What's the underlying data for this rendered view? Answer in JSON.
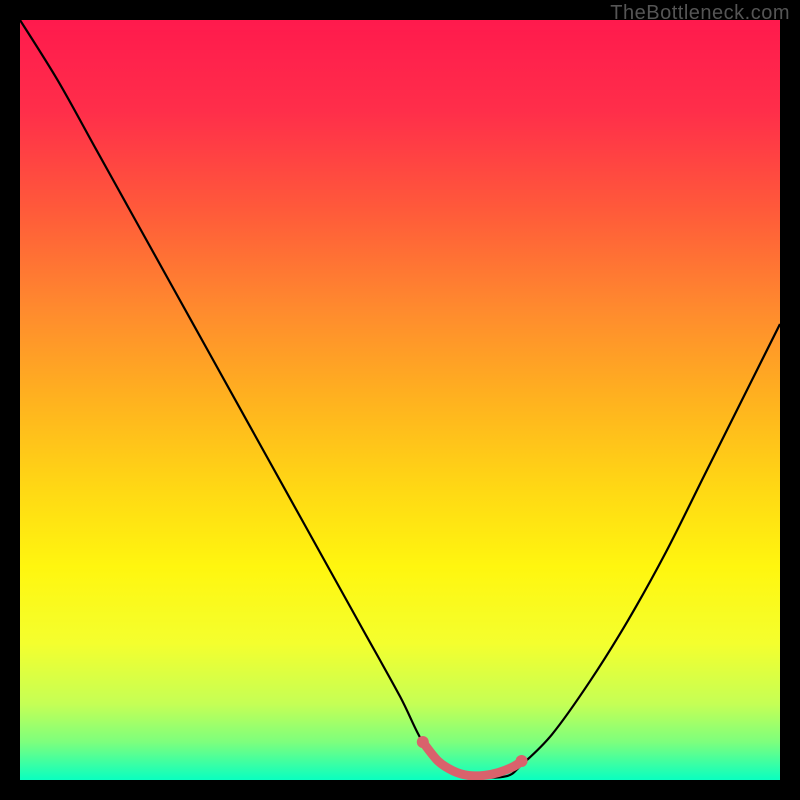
{
  "watermark": "TheBottleneck.com",
  "chart_data": {
    "type": "line",
    "title": "",
    "xlabel": "",
    "ylabel": "",
    "xlim": [
      0,
      100
    ],
    "ylim": [
      0,
      100
    ],
    "series": [
      {
        "name": "curve",
        "color": "#000000",
        "x": [
          0,
          5,
          10,
          15,
          20,
          25,
          30,
          35,
          40,
          45,
          50,
          53,
          56,
          60,
          64,
          66,
          70,
          75,
          80,
          85,
          90,
          95,
          100
        ],
        "y": [
          100,
          92,
          83,
          74,
          65,
          56,
          47,
          38,
          29,
          20,
          11,
          5,
          2,
          0.5,
          0.5,
          2,
          6,
          13,
          21,
          30,
          40,
          50,
          60
        ]
      },
      {
        "name": "highlight",
        "color": "#d9626c",
        "x": [
          53,
          55,
          57,
          59,
          61,
          63,
          65,
          66
        ],
        "y": [
          5,
          2.5,
          1.2,
          0.6,
          0.6,
          1.0,
          1.8,
          2.5
        ]
      }
    ],
    "background_gradient": {
      "stops": [
        {
          "offset": 0.0,
          "color": "#ff1a4d"
        },
        {
          "offset": 0.12,
          "color": "#ff2e4a"
        },
        {
          "offset": 0.25,
          "color": "#ff5a3a"
        },
        {
          "offset": 0.38,
          "color": "#ff8a2e"
        },
        {
          "offset": 0.5,
          "color": "#ffb21f"
        },
        {
          "offset": 0.62,
          "color": "#ffd914"
        },
        {
          "offset": 0.72,
          "color": "#fff60f"
        },
        {
          "offset": 0.82,
          "color": "#f4ff2e"
        },
        {
          "offset": 0.9,
          "color": "#c5ff55"
        },
        {
          "offset": 0.95,
          "color": "#7dff7d"
        },
        {
          "offset": 0.985,
          "color": "#2bffad"
        },
        {
          "offset": 1.0,
          "color": "#0affc0"
        }
      ]
    }
  }
}
